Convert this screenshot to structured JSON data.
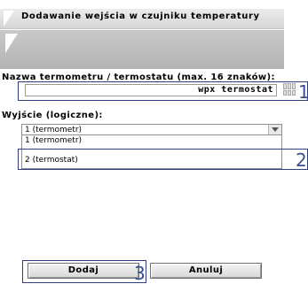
{
  "dialog": {
    "title": "Dodawanie wejścia w czujniku temperatury"
  },
  "form": {
    "name_label": "Nazwa termometru / termostatu (max. 16 znaków):",
    "name_value": "wpx termostat",
    "output_label": "Wyjście (logiczne):",
    "output_selected": "1 (termometr)",
    "output_options": [
      "1 (termometr)",
      "2 (termostat)"
    ]
  },
  "buttons": {
    "add": "Dodaj",
    "cancel": "Anuluj"
  },
  "annotations": [
    "1",
    "2",
    "3"
  ],
  "colors": {
    "annotation": "#2f3e7e",
    "header_gray": "#b4b4b4"
  }
}
